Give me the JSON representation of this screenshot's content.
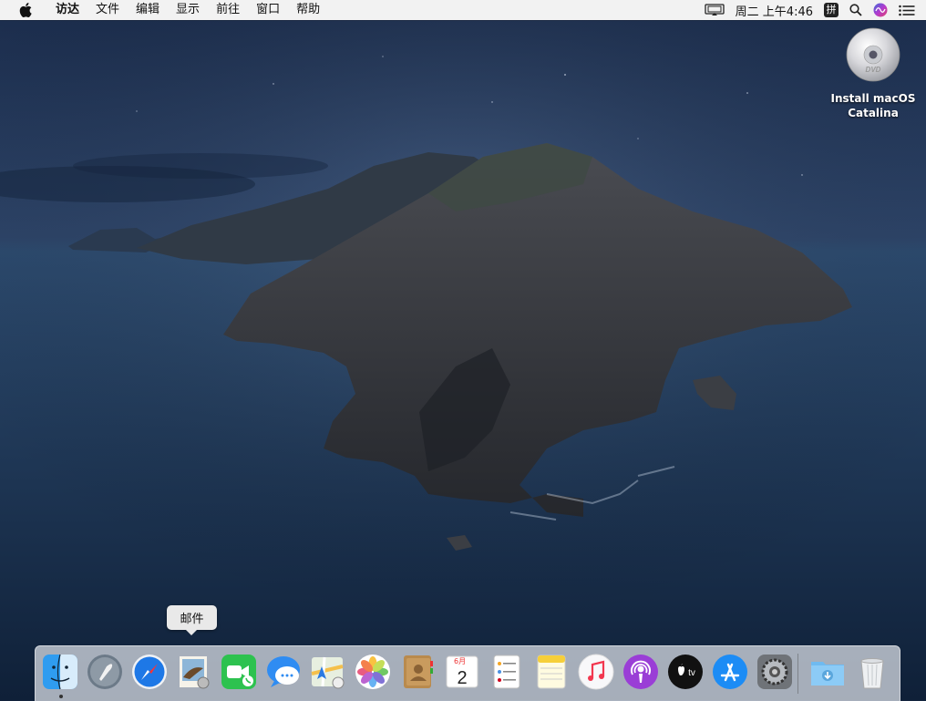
{
  "menubar": {
    "apple_icon": "apple-logo-icon",
    "items": [
      "访达",
      "文件",
      "编辑",
      "显示",
      "前往",
      "窗口",
      "帮助"
    ],
    "status": {
      "screen_mirroring_icon": "display-icon",
      "clock": "周二 上午4:46",
      "input_method": "拼",
      "search_icon": "magnifier-icon",
      "siri_icon": "siri-icon",
      "notification_icon": "list-icon"
    }
  },
  "desktop": {
    "icons": [
      {
        "label": "Install macOS Catalina",
        "icon": "dvd-disc-icon",
        "disc_text": "DVD"
      }
    ]
  },
  "tooltip": {
    "text": "邮件"
  },
  "dock": {
    "apps": [
      {
        "name": "访达",
        "icon": "finder-icon",
        "running": true
      },
      {
        "name": "启动台",
        "icon": "launchpad-icon"
      },
      {
        "name": "Safari浏览器",
        "icon": "safari-icon"
      },
      {
        "name": "邮件",
        "icon": "mail-icon"
      },
      {
        "name": "FaceTime通话",
        "icon": "facetime-icon"
      },
      {
        "name": "信息",
        "icon": "messages-icon"
      },
      {
        "name": "地图",
        "icon": "maps-icon"
      },
      {
        "name": "照片",
        "icon": "photos-icon"
      },
      {
        "name": "通讯录",
        "icon": "contacts-icon"
      },
      {
        "name": "日历",
        "icon": "calendar-icon",
        "month": "6月",
        "day": "2"
      },
      {
        "name": "提醒事项",
        "icon": "reminders-icon"
      },
      {
        "name": "备忘录",
        "icon": "notes-icon"
      },
      {
        "name": "音乐",
        "icon": "music-icon"
      },
      {
        "name": "播客",
        "icon": "podcasts-icon"
      },
      {
        "name": "TV",
        "icon": "apple-tv-icon",
        "label": "tv"
      },
      {
        "name": "App Store",
        "icon": "app-store-icon"
      },
      {
        "name": "系统偏好设置",
        "icon": "system-preferences-icon"
      }
    ],
    "others": [
      {
        "name": "下载",
        "icon": "downloads-folder-icon"
      },
      {
        "name": "废纸篓",
        "icon": "trash-icon"
      }
    ]
  }
}
